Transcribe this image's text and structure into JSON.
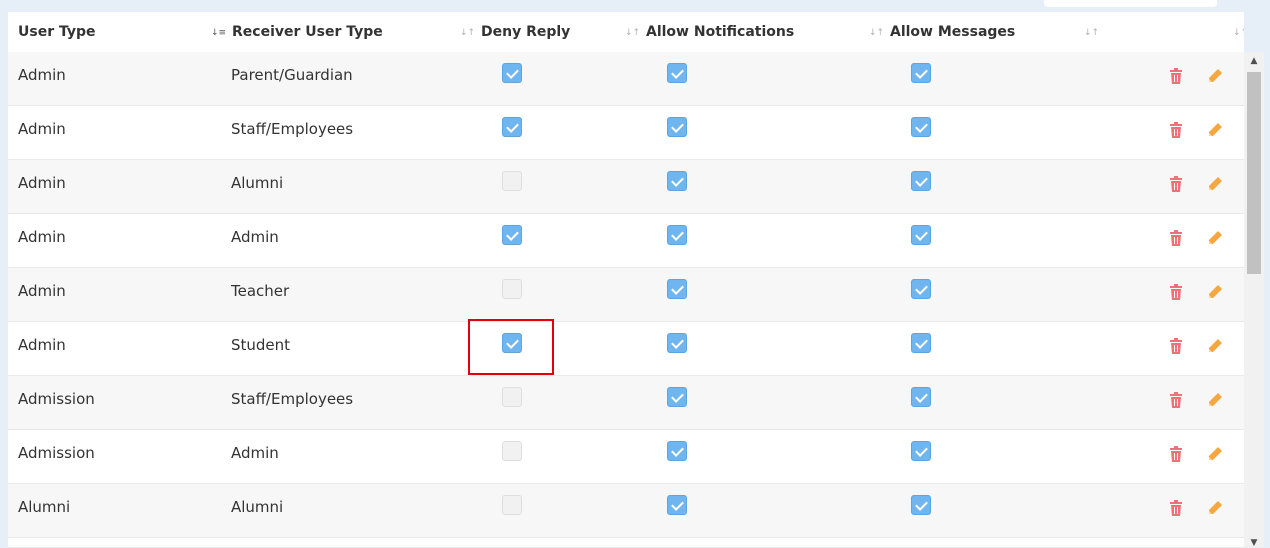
{
  "columns": {
    "user_type": "User Type",
    "receiver_user_type": "Receiver User Type",
    "deny_reply": "Deny Reply",
    "allow_notifications": "Allow Notifications",
    "allow_messages": "Allow Messages"
  },
  "icons": {
    "sort_unsorted": "sort-icon",
    "sort_active": "sort-ascending-icon",
    "delete": "trash-icon",
    "edit": "pencil-icon"
  },
  "colors": {
    "checkbox_on": "#6fb5f0",
    "delete_icon": "#f0707a",
    "edit_icon": "#f5a742",
    "highlight": "#e3000b"
  },
  "rows": [
    {
      "user_type": "Admin",
      "receiver": "Parent/Guardian",
      "deny_reply": true,
      "allow_notifications": true,
      "allow_messages": true
    },
    {
      "user_type": "Admin",
      "receiver": "Staff/Employees",
      "deny_reply": true,
      "allow_notifications": true,
      "allow_messages": true
    },
    {
      "user_type": "Admin",
      "receiver": "Alumni",
      "deny_reply": false,
      "allow_notifications": true,
      "allow_messages": true
    },
    {
      "user_type": "Admin",
      "receiver": "Admin",
      "deny_reply": true,
      "allow_notifications": true,
      "allow_messages": true
    },
    {
      "user_type": "Admin",
      "receiver": "Teacher",
      "deny_reply": false,
      "allow_notifications": true,
      "allow_messages": true
    },
    {
      "user_type": "Admin",
      "receiver": "Student",
      "deny_reply": true,
      "allow_notifications": true,
      "allow_messages": true
    },
    {
      "user_type": "Admission",
      "receiver": "Staff/Employees",
      "deny_reply": false,
      "allow_notifications": true,
      "allow_messages": true
    },
    {
      "user_type": "Admission",
      "receiver": "Admin",
      "deny_reply": false,
      "allow_notifications": true,
      "allow_messages": true
    },
    {
      "user_type": "Alumni",
      "receiver": "Alumni",
      "deny_reply": false,
      "allow_notifications": true,
      "allow_messages": true
    }
  ]
}
